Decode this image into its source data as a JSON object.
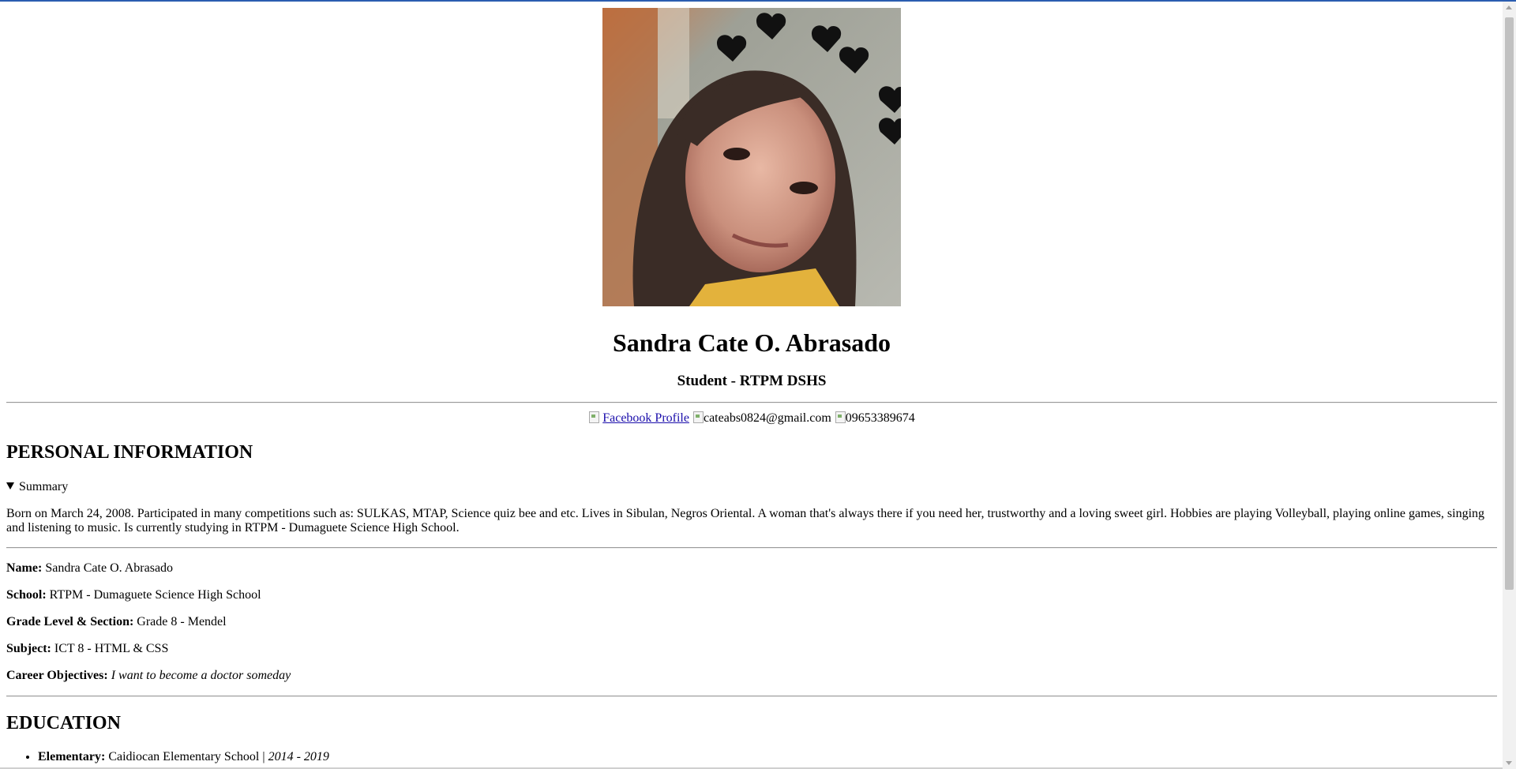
{
  "profile": {
    "name": "Sandra Cate O. Abrasado",
    "subtitle": "Student - RTPM DSHS"
  },
  "contacts": {
    "facebook_label": "Facebook Profile",
    "email": "cateabs0824@gmail.com",
    "phone": "09653389674"
  },
  "personal": {
    "heading": "PERSONAL INFORMATION",
    "summary_label": "Summary",
    "summary_text": "Born on March 24, 2008. Participated in many competitions such as: SULKAS, MTAP, Science quiz bee and etc. Lives in Sibulan, Negros Oriental. A woman that's always there if you need her, trustworthy and a loving sweet girl. Hobbies are playing Volleyball, playing online games, singing and listening to music. Is currently studying in RTPM - Dumaguete Science High School.",
    "fields": [
      {
        "label": "Name:",
        "value": "Sandra Cate O. Abrasado"
      },
      {
        "label": "School:",
        "value": "RTPM - Dumaguete Science High School"
      },
      {
        "label": "Grade Level & Section:",
        "value": "Grade 8 - Mendel"
      },
      {
        "label": "Subject:",
        "value": "ICT 8 - HTML & CSS"
      },
      {
        "label": "Career Objectives:",
        "value": "I want to become a doctor someday"
      }
    ]
  },
  "education": {
    "heading": "EDUCATION",
    "items": [
      {
        "label": "Elementary:",
        "school": "Caidiocan Elementary School",
        "separator": "|",
        "years": "2014 - 2019"
      }
    ]
  },
  "colors": {
    "link": "#1a0dab",
    "rule": "#9a9a9a",
    "scrollbar_thumb": "#c1c1c1"
  },
  "icons": {
    "profile_photo": "hearts-selfie-image",
    "contact_icons": [
      "facebook-icon",
      "email-icon",
      "phone-icon"
    ]
  }
}
